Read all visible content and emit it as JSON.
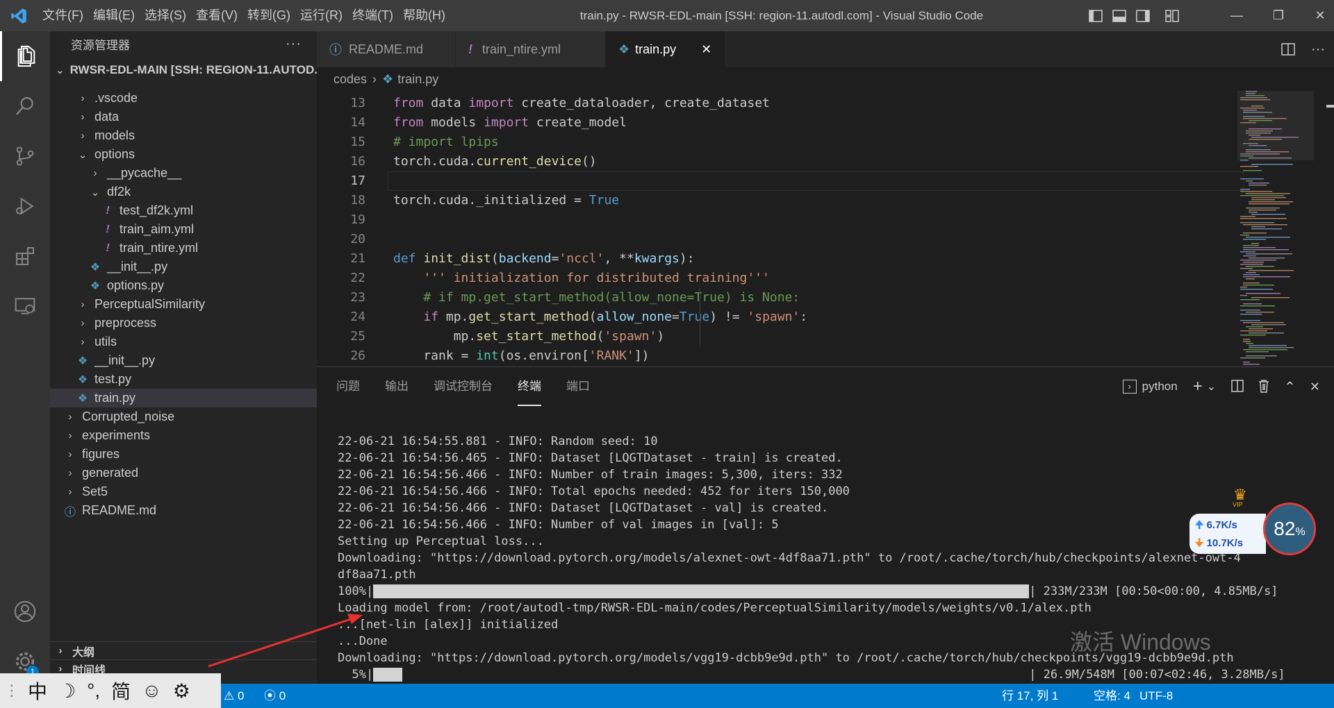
{
  "window": {
    "title": "train.py - RWSR-EDL-main [SSH: region-11.autodl.com] - Visual Studio Code",
    "menus": [
      "文件(F)",
      "编辑(E)",
      "选择(S)",
      "查看(V)",
      "转到(G)",
      "运行(R)",
      "终端(T)",
      "帮助(H)"
    ]
  },
  "explorer": {
    "header": "资源管理器",
    "root": "RWSR-EDL-MAIN [SSH: REGION-11.AUTOD...",
    "items": [
      {
        "label": ".vscode",
        "type": "folder",
        "expanded": false
      },
      {
        "label": "data",
        "type": "folder",
        "expanded": false
      },
      {
        "label": "models",
        "type": "folder",
        "expanded": false
      },
      {
        "label": "options",
        "type": "folder",
        "expanded": true
      },
      {
        "label": "__pycache__",
        "type": "folder",
        "expanded": false
      },
      {
        "label": "df2k",
        "type": "folder",
        "expanded": true
      },
      {
        "label": "test_df2k.yml",
        "type": "yml"
      },
      {
        "label": "train_aim.yml",
        "type": "yml"
      },
      {
        "label": "train_ntire.yml",
        "type": "yml"
      },
      {
        "label": "__init__.py",
        "type": "py"
      },
      {
        "label": "options.py",
        "type": "py"
      },
      {
        "label": "PerceptualSimilarity",
        "type": "folder",
        "expanded": false
      },
      {
        "label": "preprocess",
        "type": "folder",
        "expanded": false
      },
      {
        "label": "utils",
        "type": "folder",
        "expanded": false
      },
      {
        "label": "__init__.py",
        "type": "py"
      },
      {
        "label": "test.py",
        "type": "py"
      },
      {
        "label": "train.py",
        "type": "py",
        "selected": true
      },
      {
        "label": "Corrupted_noise",
        "type": "folder",
        "expanded": false
      },
      {
        "label": "experiments",
        "type": "folder",
        "expanded": false
      },
      {
        "label": "figures",
        "type": "folder",
        "expanded": false
      },
      {
        "label": "generated",
        "type": "folder",
        "expanded": false
      },
      {
        "label": "Set5",
        "type": "folder",
        "expanded": false
      },
      {
        "label": "README.md",
        "type": "info"
      }
    ],
    "outline": "大纲",
    "timeline": "时间线"
  },
  "tabs": [
    {
      "label": "README.md",
      "icon": "info-icon"
    },
    {
      "label": "train_ntire.yml",
      "icon": "yaml-icon"
    },
    {
      "label": "train.py",
      "icon": "python-icon",
      "active": true
    }
  ],
  "breadcrumb": {
    "folder": "codes",
    "file": "train.py"
  },
  "code": {
    "line_numbers": [
      "13",
      "14",
      "15",
      "16",
      "17",
      "18",
      "19",
      "20",
      "21",
      "22",
      "23",
      "24",
      "25",
      "26"
    ],
    "current_line": "17"
  },
  "panel": {
    "tabs": [
      "问题",
      "输出",
      "调试控制台",
      "终端",
      "端口"
    ],
    "active_tab": "终端",
    "terminal_name": "python",
    "lines": [
      "22-06-21 16:54:55.881 - INFO: Random seed: 10",
      "22-06-21 16:54:56.465 - INFO: Dataset [LQGTDataset - train] is created.",
      "22-06-21 16:54:56.466 - INFO: Number of train images: 5,300, iters: 332",
      "22-06-21 16:54:56.466 - INFO: Total epochs needed: 452 for iters 150,000",
      "22-06-21 16:54:56.466 - INFO: Dataset [LQGTDataset - val] is created.",
      "22-06-21 16:54:56.466 - INFO: Number of val images in [val]: 5",
      "Setting up Perceptual loss...",
      "Downloading: \"https://download.pytorch.org/models/alexnet-owt-4df8aa71.pth\" to /root/.cache/torch/hub/checkpoints/alexnet-owt-4",
      "df8aa71.pth",
      "Loading model from: /root/autodl-tmp/RWSR-EDL-main/codes/PerceptualSimilarity/models/weights/v0.1/alex.pth",
      "...[net-lin [alex]] initialized",
      "...Done",
      "Downloading: \"https://download.pytorch.org/models/vgg19-dcbb9e9d.pth\" to /root/.cache/torch/hub/checkpoints/vgg19-dcbb9e9d.pth"
    ],
    "progress1": {
      "prefix": "100%|",
      "suffix": "| 233M/233M [00:50<00:00, 4.85MB/s]",
      "fraction": 1.0
    },
    "progress2": {
      "prefix": "  5%|",
      "suffix": "| 26.9M/548M [00:07<02:46, 3.28MB/s]",
      "fraction": 0.05
    }
  },
  "status": {
    "errors": "0",
    "warnings": "0",
    "ports": "0",
    "position": "行 17, 列 1",
    "spaces": "空格: 4",
    "encoding": "UTF-8",
    "settings_badge": "1"
  },
  "overlays": {
    "ime": [
      "中",
      "☽",
      "°,",
      "简",
      "☺",
      "⚙"
    ],
    "watermark": "激活 Windows",
    "net_up": "6.7K/s",
    "net_down": "10.7K/s",
    "net_percent": "82",
    "net_percent_unit": "%",
    "vip": "VIP"
  }
}
